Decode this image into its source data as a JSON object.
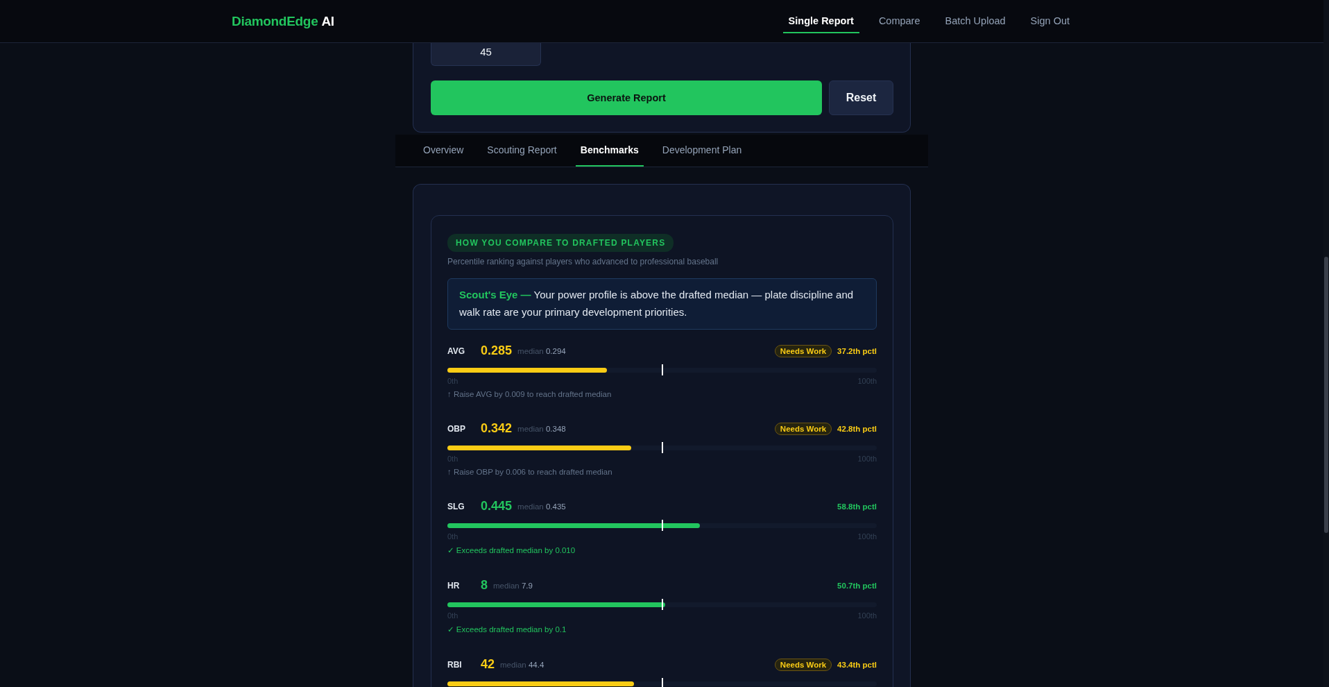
{
  "nav": {
    "logo": {
      "brand": "DiamondEdge",
      "suffix": "AI"
    },
    "links": [
      {
        "label": "Single Report",
        "selected": true
      },
      {
        "label": "Compare",
        "selected": false
      },
      {
        "label": "Batch Upload",
        "selected": false
      },
      {
        "label": "Sign Out",
        "selected": false
      }
    ]
  },
  "form": {
    "field_value": "45",
    "buttons": [
      {
        "label": "Generate Report",
        "kind": "primary"
      },
      {
        "label": "Reset",
        "kind": "secondary"
      }
    ]
  },
  "tabs": [
    {
      "label": "Overview",
      "selected": false
    },
    {
      "label": "Scouting Report",
      "selected": false
    },
    {
      "label": "Benchmarks",
      "selected": true
    },
    {
      "label": "Development Plan",
      "selected": false
    }
  ],
  "benchmarks": {
    "badge": "HOW YOU COMPARE TO DRAFTED PLAYERS",
    "subtitle": "Percentile ranking against players who advanced to professional baseball",
    "insight": {
      "lead": "Scout's Eye —",
      "text": "Your power profile is above the drafted median — plate discipline and walk rate are your primary development priorities."
    },
    "metrics": [
      {
        "stat": "AVG",
        "value": "0.285",
        "median_label": "median",
        "median": "0.294",
        "kind": "below",
        "status": "Needs Work",
        "percentile": "37.2th pctl",
        "level": 0.372,
        "scale_min": "0th",
        "scale_max": "100th",
        "note": "↑ Raise AVG by 0.009 to reach drafted median"
      },
      {
        "stat": "OBP",
        "value": "0.342",
        "median_label": "median",
        "median": "0.348",
        "kind": "below",
        "status": "Needs Work",
        "percentile": "42.8th pctl",
        "level": 0.428,
        "scale_min": "0th",
        "scale_max": "100th",
        "note": "↑ Raise OBP by 0.006 to reach drafted median"
      },
      {
        "stat": "SLG",
        "value": "0.445",
        "median_label": "median",
        "median": "0.435",
        "kind": "above",
        "percentile": "58.8th pctl",
        "level": 0.588,
        "scale_min": "0th",
        "scale_max": "100th",
        "note": "✓ Exceeds drafted median by 0.010"
      },
      {
        "stat": "HR",
        "value": "8",
        "median_label": "median",
        "median": "7.9",
        "kind": "above",
        "percentile": "50.7th pctl",
        "level": 0.507,
        "scale_min": "0th",
        "scale_max": "100th",
        "note": "✓ Exceeds drafted median by 0.1"
      },
      {
        "stat": "RBI",
        "value": "42",
        "median_label": "median",
        "median": "44.4",
        "kind": "below",
        "status": "Needs Work",
        "percentile": "43.4th pctl",
        "level": 0.434
      }
    ]
  }
}
